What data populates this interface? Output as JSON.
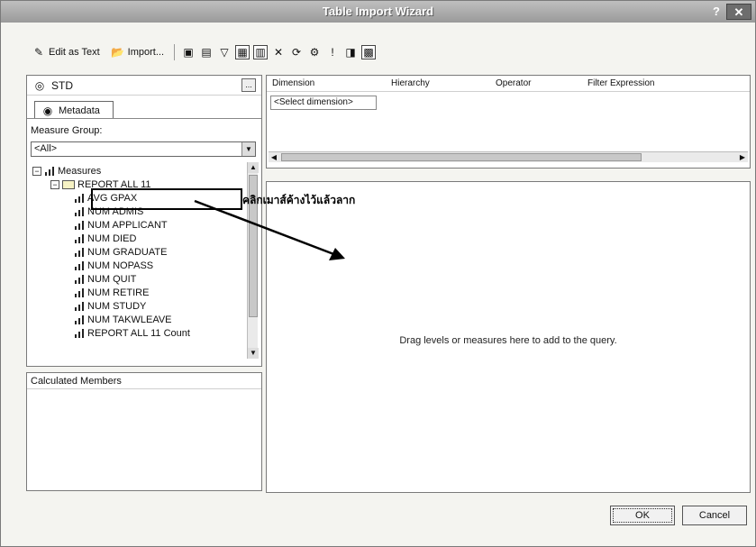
{
  "window": {
    "title": "Table Import Wizard",
    "help_label": "?",
    "close_label": "✕"
  },
  "toolbar": {
    "edit_as_text": "Edit as Text",
    "import": "Import..."
  },
  "cube": {
    "name": "STD",
    "ellipsis": "..."
  },
  "metadata_tab": "Metadata",
  "measure_group": {
    "label": "Measure Group:",
    "value": "<All>"
  },
  "tree": {
    "root": "Measures",
    "folder": "REPORT ALL 11",
    "items": [
      "AVG GPAX",
      "NUM ADMIS",
      "NUM APPLICANT",
      "NUM DIED",
      "NUM GRADUATE",
      "NUM NOPASS",
      "NUM QUIT",
      "NUM RETIRE",
      "NUM STUDY",
      "NUM TAKWLEAVE",
      "REPORT ALL 11 Count"
    ]
  },
  "calculated_members": "Calculated Members",
  "filter": {
    "headers": [
      "Dimension",
      "Hierarchy",
      "Operator",
      "Filter Expression"
    ],
    "select_dimension": "<Select dimension>"
  },
  "query": {
    "hint": "Drag levels or measures here to add to the query."
  },
  "annotation": {
    "text": "คลิกเมาส์ค้างไว้แล้วลาก"
  },
  "buttons": {
    "ok": "OK",
    "cancel": "Cancel"
  }
}
